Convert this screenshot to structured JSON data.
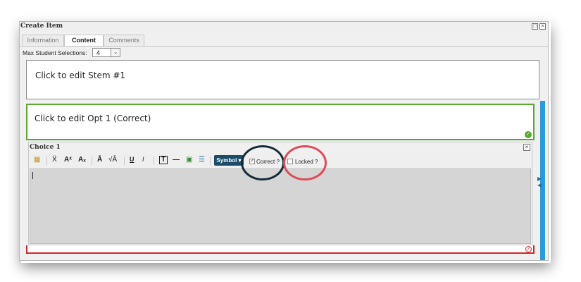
{
  "window": {
    "title": "Create Item",
    "restore_glyph": "□",
    "close_glyph": "×"
  },
  "tabs": [
    {
      "label": "Information",
      "active": false
    },
    {
      "label": "Content",
      "active": true
    },
    {
      "label": "Comments",
      "active": false
    }
  ],
  "max_selections": {
    "label": "Max Student Selections:",
    "value": "4",
    "arrow": "⌄"
  },
  "stem": {
    "text": "Click to edit Stem #1"
  },
  "option1": {
    "text": "Click to edit Opt 1 (Correct)",
    "status_glyph": "✓",
    "border_color": "#5aa830"
  },
  "choice_panel": {
    "title": "Choice 1",
    "close_glyph": "×",
    "toolbar": {
      "insert_icon": "▦",
      "spell_icon": "Ẍ",
      "superscript": "Aˣ",
      "subscript": "Aₓ",
      "overline": "Ā",
      "sqrt": "√Ā",
      "underline": "U",
      "italic": "I",
      "textbox": "T",
      "hr": "—",
      "image_icon": "▣",
      "list_icon": "☰",
      "symbol_label": "Symbol ▾",
      "correct_label": "Correct ?",
      "correct_checked": true,
      "locked_label": "Locked ?",
      "locked_checked": false
    },
    "editor_content": ""
  },
  "option2": {
    "border_color": "#d02828",
    "status_glyph": "✓"
  },
  "annotations": {
    "dark_circle_color": "#152c38",
    "red_circle_color": "#e04a58"
  }
}
